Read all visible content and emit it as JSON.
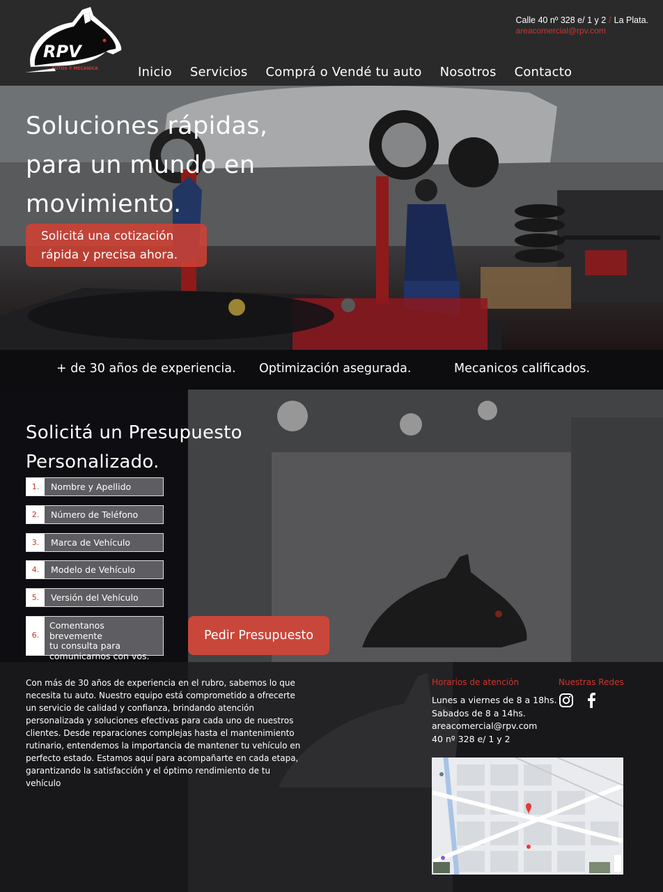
{
  "header": {
    "logo_text": "RPV",
    "logo_subtext": "AUTOS Y MECANICA",
    "address": "Calle 40 nº 328 e/ 1 y 2",
    "separator": "/",
    "city": "La Plata.",
    "email": "areacomercial@rpv.com"
  },
  "nav": {
    "items": [
      {
        "label": "Inicio"
      },
      {
        "label": "Servicios"
      },
      {
        "label": "Comprá o Vendé tu auto"
      },
      {
        "label": "Nosotros"
      },
      {
        "label": "Contacto"
      }
    ]
  },
  "hero": {
    "title_line1": "Soluciones rápidas,",
    "title_line2": "para un mundo en",
    "title_line3": "movimiento.",
    "cta_line1": "Solicitá una cotización",
    "cta_line2": "rápida y precisa ahora."
  },
  "features": [
    {
      "label": "+ de 30 años de experiencia."
    },
    {
      "label": "Optimización asegurada."
    },
    {
      "label": "Mecanicos calificados."
    }
  ],
  "quote": {
    "title_line1": "Solicitá un Presupuesto",
    "title_line2": "Personalizado.",
    "fields": [
      {
        "num": "1.",
        "label": "Nombre y Apellido"
      },
      {
        "num": "2.",
        "label": "Número de Teléfono"
      },
      {
        "num": "3.",
        "label": "Marca de Vehículo"
      },
      {
        "num": "4.",
        "label": "Modelo de Vehículo"
      },
      {
        "num": "5.",
        "label": "Versión del Vehículo"
      }
    ],
    "message": {
      "num": "6.",
      "line1": "Comentanos brevemente",
      "line2": "tu consulta para",
      "line3": "comunicarnos con vos."
    },
    "submit_label": "Pedir Presupuesto"
  },
  "footer": {
    "about": "Con más de 30 años de experiencia en el rubro, sabemos lo que necesita tu auto. Nuestro equipo está comprometido a ofrecerte un servicio de calidad y confianza, brindando atención personalizada y soluciones efectivas para cada uno de nuestros clientes. Desde reparaciones complejas hasta el mantenimiento rutinario, entendemos la importancia de mantener tu vehículo en perfecto estado. Estamos aquí para acompañarte en cada etapa, garantizando la satisfacción y el óptimo rendimiento de tu vehículo",
    "hours_title": "Horarios de  atención",
    "social_title": "Nuestras Redes",
    "hours_line1": "Lunes a viernes de 8 a 18hs.",
    "hours_line2": "Sabados de 8 a 14hs.",
    "email": "areacomercial@rpv.com",
    "address": "40 nº 328 e/ 1 y 2",
    "social": [
      "instagram-icon",
      "facebook-icon"
    ]
  },
  "colors": {
    "accent": "#d2342a",
    "header_bg": "#2a2a2b",
    "button_bg": "#c9473a",
    "field_bg": "#5d5d62"
  }
}
